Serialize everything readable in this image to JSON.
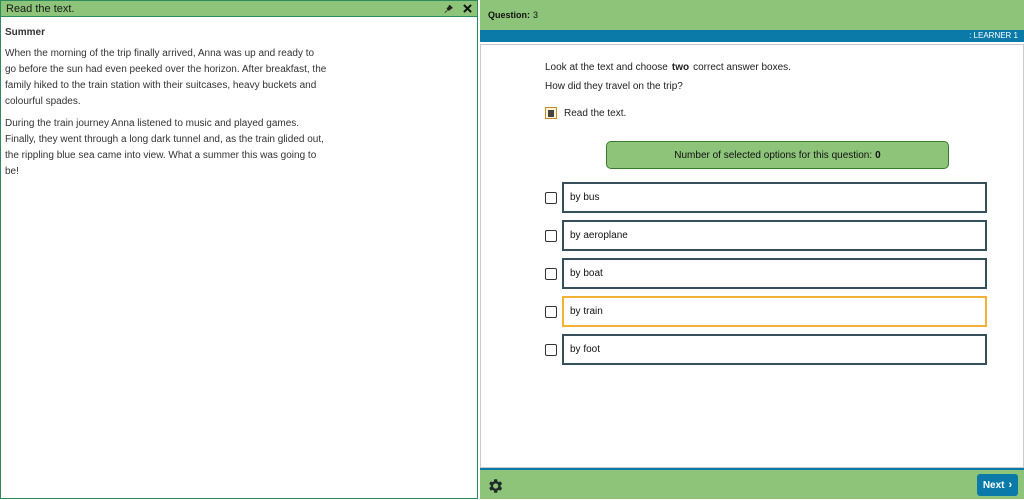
{
  "reading_panel": {
    "title": "Read the text.",
    "pin_icon": "pin-icon",
    "close_icon": "close-icon",
    "passage_title": "Summer",
    "paragraphs": [
      "When the morning of the trip finally arrived, Anna was up and ready to go before the sun had even peeked over the horizon. After breakfast, the family hiked to the train station with their suitcases, heavy buckets and colourful spades.",
      "During the train journey Anna listened to music and played games. Finally, they went through a long dark tunnel and, as the train glided out, the rippling blue sea came into view. What a summer this was going to be!"
    ]
  },
  "topbar": {
    "question_label": "Question:",
    "question_number": "3"
  },
  "learner_bar": ": LEARNER 1",
  "main": {
    "instruction_pre": "Look at the text and choose",
    "instruction_bold": "two",
    "instruction_post": "correct answer boxes.",
    "question": "How did they travel on the trip?",
    "read_link": "Read the text.",
    "counter_label": "Number of selected options for this question:",
    "counter_value": "0",
    "options": [
      {
        "label": "by bus"
      },
      {
        "label": "by aeroplane"
      },
      {
        "label": "by boat"
      },
      {
        "label": "by train"
      },
      {
        "label": "by foot"
      }
    ]
  },
  "footer": {
    "settings_icon": "gear-icon",
    "next_label": "Next"
  },
  "colors": {
    "green": "#8dc47a",
    "blue": "#0b7aa8",
    "hover": "#f2b233"
  }
}
